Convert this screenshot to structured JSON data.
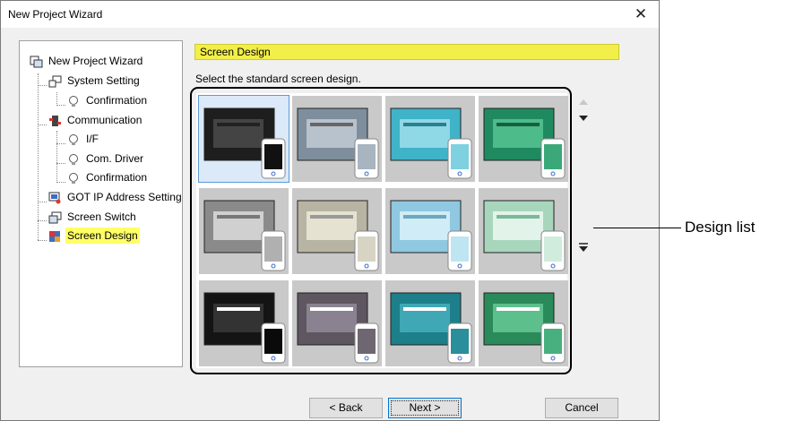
{
  "window": {
    "title": "New Project Wizard",
    "close_glyph": "✕"
  },
  "tree": {
    "items": [
      {
        "label": "New Project Wizard"
      },
      {
        "label": "System Setting"
      },
      {
        "label": "Confirmation"
      },
      {
        "label": "Communication"
      },
      {
        "label": "I/F"
      },
      {
        "label": "Com. Driver"
      },
      {
        "label": "Confirmation"
      },
      {
        "label": "GOT IP Address Setting"
      },
      {
        "label": "Screen Switch"
      },
      {
        "label": "Screen Design"
      }
    ]
  },
  "header": {
    "title": "Screen Design"
  },
  "instruction": "Select the standard screen design.",
  "designs": [
    {
      "name": "black",
      "bg": "#1e1e1e",
      "accent": "#444444",
      "phone": "#111111"
    },
    {
      "name": "gray-blue",
      "bg": "#7e8e9c",
      "accent": "#b8c2cc",
      "phone": "#a8b4c0"
    },
    {
      "name": "cyan",
      "bg": "#3fb3c8",
      "accent": "#8fd8e6",
      "phone": "#7fd0e0"
    },
    {
      "name": "green",
      "bg": "#1f8a60",
      "accent": "#4dbb8a",
      "phone": "#3aa878"
    },
    {
      "name": "light-gray",
      "bg": "#8a8a8a",
      "accent": "#d0d0d0",
      "phone": "#b0b0b0"
    },
    {
      "name": "beige",
      "bg": "#b8b4a4",
      "accent": "#e6e2d2",
      "phone": "#d8d4c4"
    },
    {
      "name": "light-cyan",
      "bg": "#8fc8e0",
      "accent": "#d0ecf6",
      "phone": "#bfe4f2"
    },
    {
      "name": "light-green",
      "bg": "#a8d6bc",
      "accent": "#e2f4ea",
      "phone": "#d0ecdc"
    },
    {
      "name": "black-2",
      "bg": "#141414",
      "accent": "#333333",
      "phone": "#0a0a0a"
    },
    {
      "name": "mauve",
      "bg": "#5e5660",
      "accent": "#8a8290",
      "phone": "#6e6670"
    },
    {
      "name": "teal",
      "bg": "#1c7f8a",
      "accent": "#3fa8b4",
      "phone": "#2a8f9a"
    },
    {
      "name": "emerald",
      "bg": "#2a8a5a",
      "accent": "#5cbf8c",
      "phone": "#48b07e"
    }
  ],
  "buttons": {
    "back": "< Back",
    "next": "Next >",
    "cancel": "Cancel"
  },
  "callout": {
    "label": "Design list"
  },
  "colors": {
    "selection_yellow": "#ffff66",
    "header_yellow": "#f2ee4a",
    "selection_blue": "#5b9bd5"
  }
}
